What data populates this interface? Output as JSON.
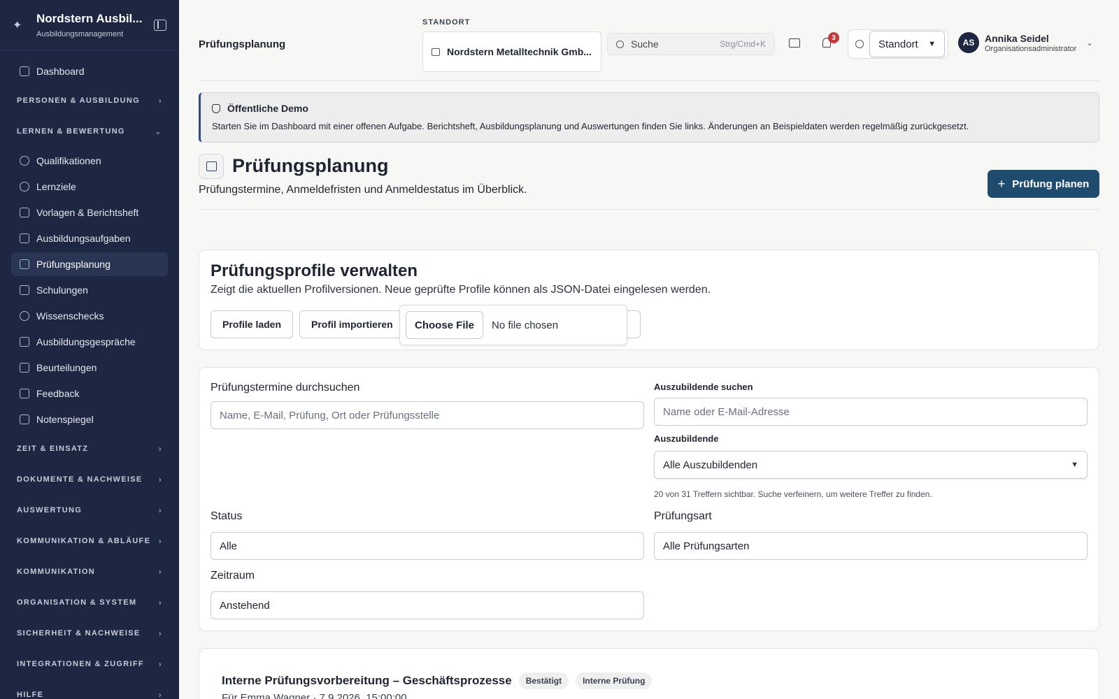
{
  "brand": {
    "title": "Nordstern Ausbil...",
    "subtitle": "Ausbildungsmanagement"
  },
  "sidebar": {
    "dashboard": "Dashboard",
    "sections": {
      "personen": "PERSONEN & AUSBILDUNG",
      "lernen": "LERNEN & BEWERTUNG",
      "zeit": "ZEIT & EINSATZ",
      "dokumente": "DOKUMENTE & NACHWEISE",
      "auswertung": "AUSWERTUNG",
      "kommablaeufe": "KOMMUNIKATION & ABLÄUFE",
      "kommunikation": "KOMMUNIKATION",
      "organisation": "ORGANISATION & SYSTEM",
      "sicherheit": "SICHERHEIT & NACHWEISE",
      "integrationen": "INTEGRATIONEN & ZUGRIFF",
      "hilfe": "HILFE"
    },
    "lernen_items": [
      "Qualifikationen",
      "Lernziele",
      "Vorlagen & Berichtsheft",
      "Ausbildungsaufgaben",
      "Prüfungsplanung",
      "Schulungen",
      "Wissenschecks",
      "Ausbildungsgespräche",
      "Beurteilungen",
      "Feedback",
      "Notenspiegel"
    ]
  },
  "topbar": {
    "page_title": "Prüfungsplanung",
    "standort_label": "STANDORT",
    "standort_value": "Nordstern Metalltechnik Gmb...",
    "search_placeholder": "Suche",
    "search_shortcut": "Strg/Cmd+K",
    "notification_count": "3",
    "theme_select": "Standort",
    "user": {
      "initials": "AS",
      "name": "Annika Seidel",
      "role": "Organisationsadministrator"
    }
  },
  "banner": {
    "title": "Öffentliche Demo",
    "text": "Starten Sie im Dashboard mit einer offenen Aufgabe. Berichtsheft, Ausbildungsplanung und Auswertungen finden Sie links. Änderungen an Beispieldaten werden regelmäßig zurückgesetzt."
  },
  "page": {
    "title": "Prüfungsplanung",
    "subtitle": "Prüfungstermine, Anmeldefristen und Anmeldestatus im Überblick.",
    "primary_button": "Prüfung planen"
  },
  "profiles": {
    "title": "Prüfungsprofile verwalten",
    "subtitle": "Zeigt die aktuellen Profilversionen. Neue geprüfte Profile können als JSON-Datei eingelesen werden.",
    "load_button": "Profile laden",
    "import_button": "Profil importieren",
    "file_button": "Choose File",
    "file_status": "No file chosen"
  },
  "filters": {
    "search_label": "Prüfungstermine durchsuchen",
    "search_placeholder": "Name, E-Mail, Prüfung, Ort oder Prüfungsstelle",
    "trainee_search_label": "Auszubildende suchen",
    "trainee_search_placeholder": "Name oder E-Mail-Adresse",
    "trainee_label": "Auszubildende",
    "trainee_value": "Alle Auszubildenden",
    "trainee_hint": "20 von 31 Treffern sichtbar. Suche verfeinern, um weitere Treffer zu finden.",
    "status_label": "Status",
    "status_value": "Alle",
    "type_label": "Prüfungsart",
    "type_value": "Alle Prüfungsarten",
    "period_label": "Zeitraum",
    "period_value": "Anstehend"
  },
  "exam": {
    "title": "Interne Prüfungsvorbereitung – Geschäftsprozesse",
    "badge_status": "Bestätigt",
    "badge_type": "Interne Prüfung",
    "subtitle": "Für Emma Wagner · 7.9.2026, 15:00:00"
  }
}
